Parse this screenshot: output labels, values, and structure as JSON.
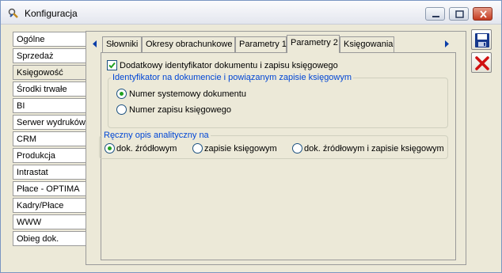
{
  "window": {
    "title": "Konfiguracja"
  },
  "nav": {
    "items": [
      {
        "label": "Ogólne"
      },
      {
        "label": "Sprzedaż"
      },
      {
        "label": "Księgowość"
      },
      {
        "label": "Środki trwałe"
      },
      {
        "label": "BI"
      },
      {
        "label": "Serwer wydruków"
      },
      {
        "label": "CRM"
      },
      {
        "label": "Produkcja"
      },
      {
        "label": "Intrastat"
      },
      {
        "label": "Płace - OPTIMA"
      },
      {
        "label": "Kadry/Płace"
      },
      {
        "label": "WWW"
      },
      {
        "label": "Obieg dok."
      }
    ],
    "active_index": 2
  },
  "tabs": [
    {
      "label": "Słowniki"
    },
    {
      "label": "Okresy obrachunkowe"
    },
    {
      "label": "Parametry 1"
    },
    {
      "label": "Parametry 2"
    },
    {
      "label": "Księgowania"
    }
  ],
  "active_tab": "Parametry 2",
  "page": {
    "extra_id_checkbox": {
      "label": "Dodatkowy identyfikator dokumentu i zapisu księgowego",
      "checked": true
    },
    "id_group": {
      "title": "Identyfikator na dokumencie i powiązanym zapisie księgowym",
      "options": [
        {
          "label": "Numer systemowy dokumentu",
          "selected": true
        },
        {
          "label": "Numer zapisu księgowego",
          "selected": false
        }
      ]
    },
    "desc_group": {
      "title": "Ręczny opis analityczny na",
      "options": [
        {
          "label": "dok. źródłowym",
          "selected": true
        },
        {
          "label": "zapisie księgowym",
          "selected": false
        },
        {
          "label": "dok. źródłowym i zapisie księgowym",
          "selected": false
        }
      ]
    }
  },
  "actions": {
    "save_icon": "floppy-disk-icon",
    "cancel_icon": "red-x-icon"
  },
  "colors": {
    "accent_text": "#0046d5",
    "radio_dot": "#21a121",
    "cancel": "#d01010"
  }
}
